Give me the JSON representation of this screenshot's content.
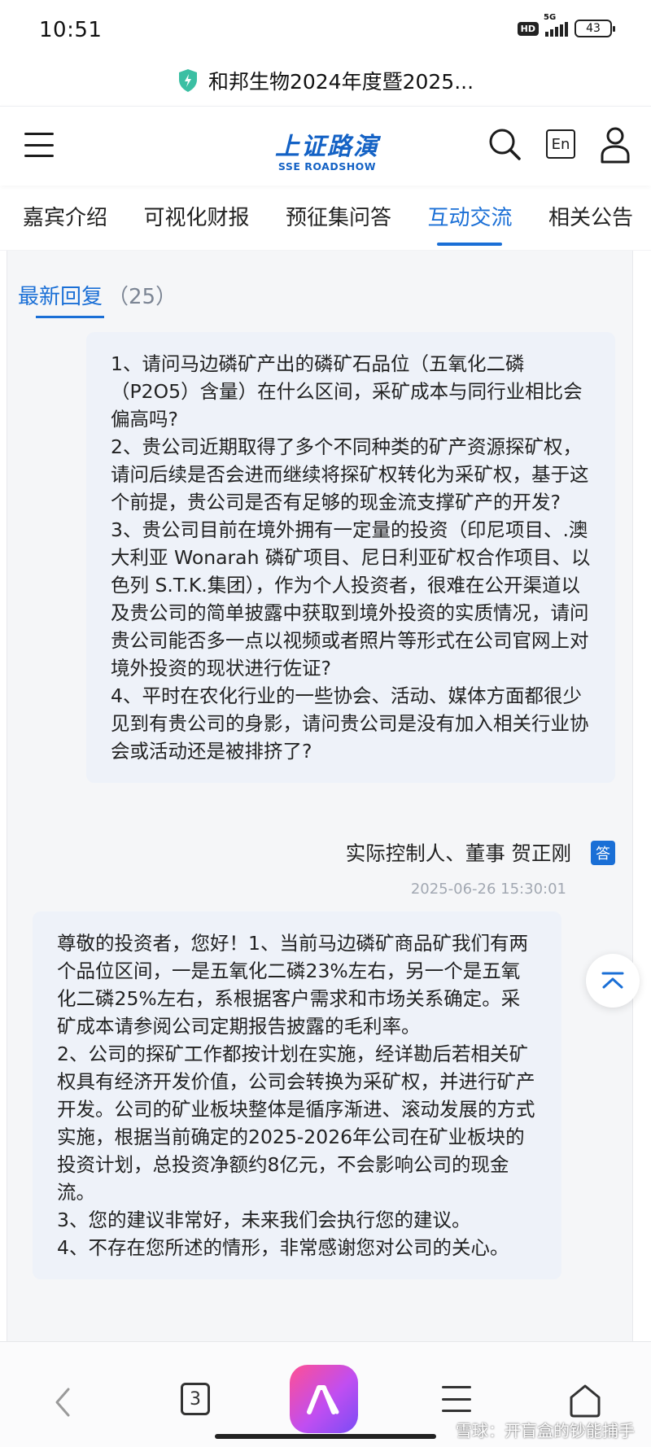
{
  "status_bar": {
    "time": "10:51",
    "hd": "HD",
    "network": "5G",
    "battery": "43"
  },
  "browser": {
    "page_title": "和邦生物2024年度暨2025..."
  },
  "header": {
    "logo_cn": "上证路演",
    "logo_en": "SSE ROADSHOW",
    "lang_button": "En"
  },
  "tabs": [
    {
      "label": "嘉宾介绍",
      "active": false
    },
    {
      "label": "可视化财报",
      "active": false
    },
    {
      "label": "预征集问答",
      "active": false
    },
    {
      "label": "互动交流",
      "active": true
    },
    {
      "label": "相关公告",
      "active": false
    }
  ],
  "subtab": {
    "label": "最新回复",
    "count": "（25）"
  },
  "question": {
    "lines": [
      "1、请问马边磷矿产出的磷矿石品位（五氧化二磷（P2O5）含量）在什么区间，采矿成本与同行业相比会偏高吗?",
      "2、贵公司近期取得了多个不同种类的矿产资源探矿权，请问后续是否会进而继续将探矿权转化为采矿权，基于这个前提，贵公司是否有足够的现金流支撑矿产的开发?",
      "3、贵公司目前在境外拥有一定量的投资（印尼项目、.澳大利亚 Wonarah 磷矿项目、尼日利亚矿权合作项目、以色列 S.T.K.集团），作为个人投资者，很难在公开渠道以及贵公司的简单披露中获取到境外投资的实质情况，请问贵公司能否多一点以视频或者照片等形式在公司官网上对境外投资的现状进行佐证?",
      "4、平时在农化行业的一些协会、活动、媒体方面都很少见到有贵公司的身影，请问贵公司是没有加入相关行业协会或活动还是被排挤了?"
    ]
  },
  "answer": {
    "author": "实际控制人、董事 贺正刚",
    "badge": "答",
    "time": "2025-06-26 15:30:01",
    "lines": [
      "尊敬的投资者，您好！1、当前马边磷矿商品矿我们有两个品位区间，一是五氧化二磷23%左右，另一个是五氧化二磷25%左右，系根据客户需求和市场关系确定。采矿成本请参阅公司定期报告披露的毛利率。",
      "2、公司的探矿工作都按计划在实施，经详勘后若相关矿权具有经济开发价值，公司会转换为采矿权，并进行矿产开发。公司的矿业板块整体是循序渐进、滚动发展的方式实施，根据当前确定的2025-2026年公司在矿业板块的投资计划，总投资净额约8亿元，不会影响公司的现金流。",
      "3、您的建议非常好，未来我们会执行您的建议。",
      "4、不存在您所述的情形，非常感谢您对公司的关心。"
    ]
  },
  "bottom_nav": {
    "tab_count": "3"
  },
  "watermark": "雪球：开盲盒的钞能捕手",
  "colors": {
    "accent": "#1a6fd6",
    "card_bg": "#eef2f9",
    "panel_bg": "#f5f6f8"
  }
}
